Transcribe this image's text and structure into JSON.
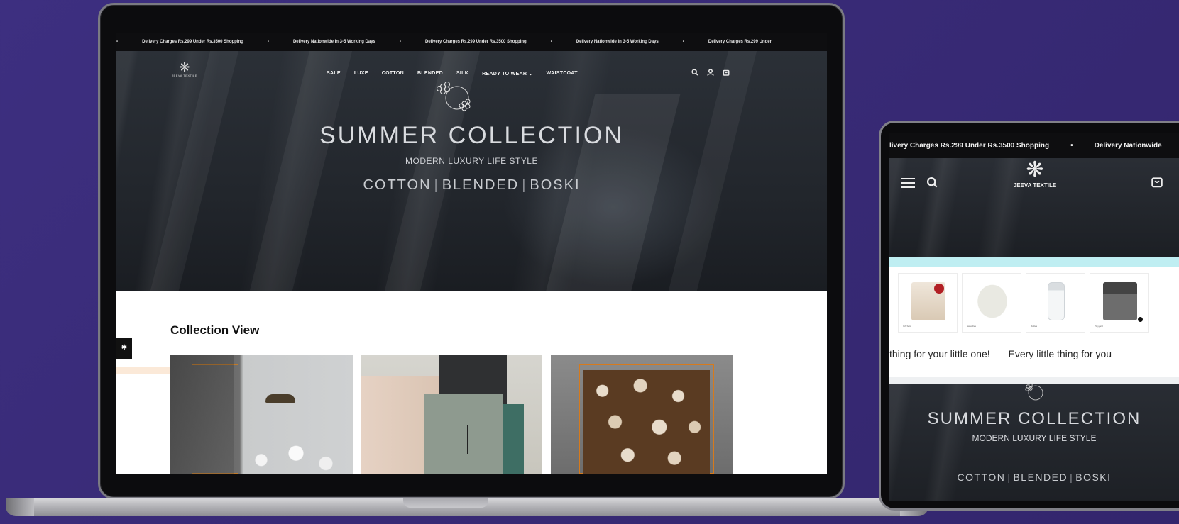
{
  "laptop": {
    "announcement": [
      "Delivery Charges Rs.299 Under Rs.3500 Shopping",
      "Delivery Nationwide In 3-5 Working Days",
      "Delivery Charges Rs.299 Under Rs.3500 Shopping",
      "Delivery Nationwide In 3-5 Working Days",
      "Delivery Charges Rs.299 Under"
    ],
    "logo_text": "JEEVA TEXTILE",
    "nav": [
      "SALE",
      "LUXE",
      "COTTON",
      "BLENDED",
      "SILK",
      "READY TO WEAR",
      "WAISTCOAT"
    ],
    "nav_dropdown_caret": "⌄",
    "hero": {
      "title": "SUMMER COLLECTION",
      "subtitle": "MODERN LUXURY LIFE STYLE",
      "cat1": "COTTON",
      "cat2": "BLENDED",
      "cat3": "BOSKI",
      "separator": "|"
    },
    "collection_title": "Collection View"
  },
  "tablet": {
    "announcement": [
      "livery Charges Rs.299 Under Rs.3500 Shopping",
      "•",
      "Delivery Nationwide"
    ],
    "logo_text": "JEEVA TEXTILE",
    "products": [
      "Gift Sets",
      "Swaddles",
      "Bottles",
      "Playyard"
    ],
    "marquee": [
      "thing for your little one!",
      "Every little thing for you"
    ],
    "hero": {
      "title": "SUMMER COLLECTION",
      "subtitle": "MODERN LUXURY LIFE STYLE",
      "cat1": "COTTON",
      "cat2": "BLENDED",
      "cat3": "BOSKI",
      "separator": "|"
    }
  },
  "colors": {
    "background": "#3a2d7a",
    "announcement_bg": "#0e0e10",
    "hero_bg": "#22262c",
    "accent_frame": "#c07a2a",
    "tablet_strip": "#bfeef2",
    "side_bar": "#fbe9d8"
  },
  "icons": [
    "search-icon",
    "user-icon",
    "cart-icon",
    "menu-icon",
    "flower-emblem-icon",
    "snowflake-logo-icon"
  ]
}
